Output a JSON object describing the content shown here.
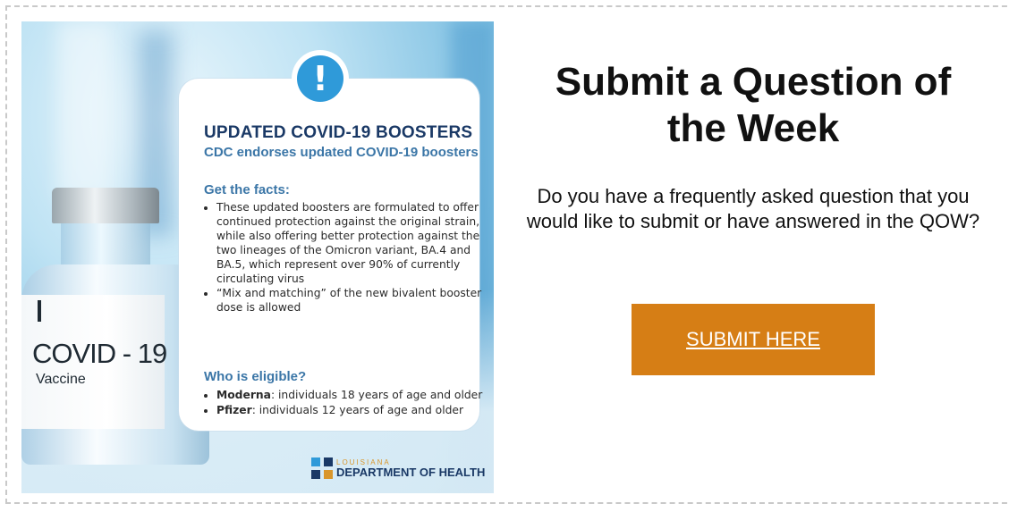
{
  "promo_image": {
    "vial": {
      "line1": "COVID - 19",
      "line2": "Vaccine"
    },
    "card": {
      "title": "UPDATED COVID-19 BOOSTERS",
      "subtitle": "CDC endorses updated COVID-19 boosters",
      "facts_heading": "Get the facts:",
      "facts": [
        "These updated boosters are formulated to offer continued protection against the original strain, while also offering better protection against the two lineages of the Omicron variant, BA.4 and BA.5, which represent over 90% of currently circulating virus",
        "“Mix and matching” of the new bivalent booster dose is allowed"
      ],
      "eligibility_heading": "Who is eligible?",
      "eligibility": [
        {
          "brand": "Moderna",
          "text": ": individuals 18 years of age and older"
        },
        {
          "brand": "Pfizer",
          "text": ": individuals 12 years of age and older"
        }
      ]
    },
    "logo": {
      "small": "LOUISIANA",
      "big": "DEPARTMENT OF HEALTH"
    },
    "alert_symbol": "!"
  },
  "cta": {
    "title": "Submit a Question of the Week",
    "description": "Do you have a frequently asked question that you would like to submit or have answered in the QOW?",
    "button_label": "SUBMIT HERE",
    "button_color": "#d67e15"
  }
}
